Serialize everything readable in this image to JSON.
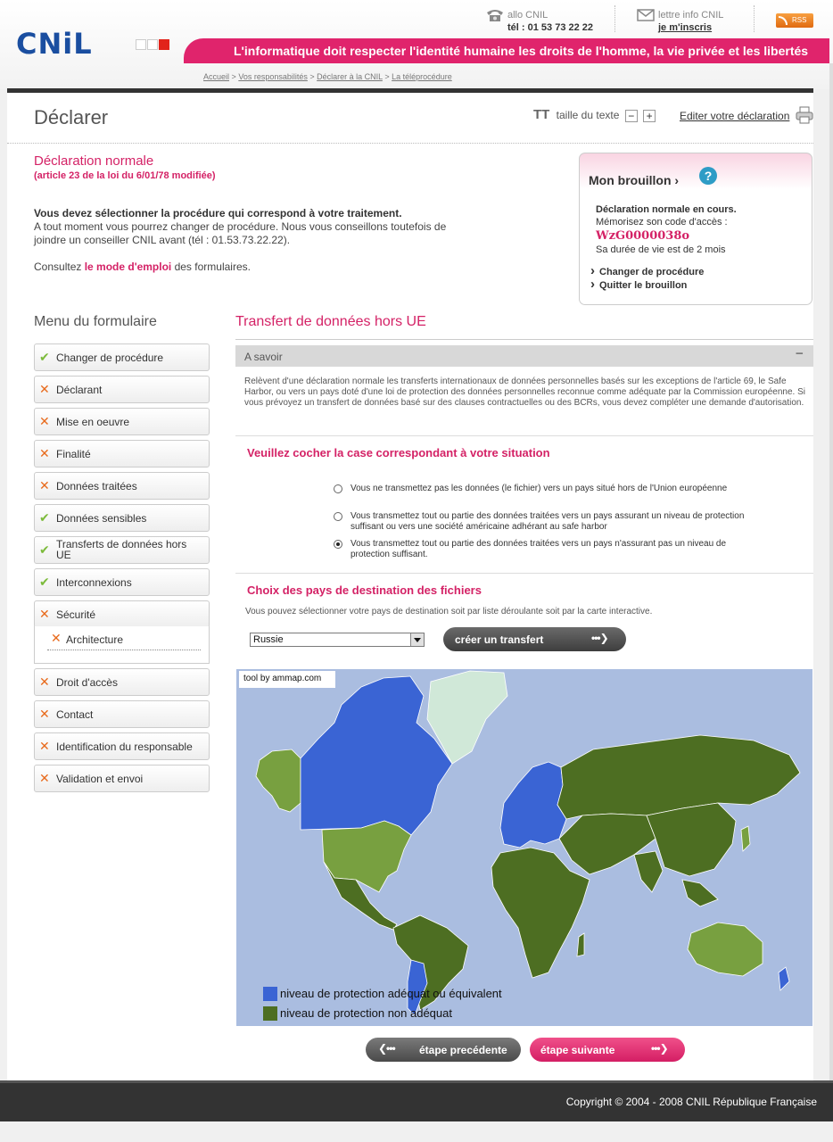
{
  "header": {
    "logo_text": "CNiL",
    "tagline": "L'informatique doit respecter l'identité humaine les droits de l'homme, la vie privée et les libertés",
    "allo_label": "allo CNIL",
    "allo_phone": "tél : 01 53 73 22 22",
    "lettre_label": "lettre info CNIL",
    "lettre_link": "je m'inscris",
    "rss": "RSS",
    "colors": {
      "brand_blue": "#1a4ea0",
      "accent_pink": "#e0246c"
    }
  },
  "breadcrumb": {
    "items": [
      "Accueil",
      "Vos responsabilités",
      "Déclarer à la CNIL",
      "La téléprocédure"
    ],
    "sep": ">"
  },
  "page": {
    "title": "Déclarer",
    "text_size_icon": "TT",
    "text_size_label": "taille du texte",
    "minus": "−",
    "plus": "+",
    "edit_label": "Editer votre déclaration"
  },
  "declaration": {
    "title": "Déclaration normale",
    "subtitle": "(article 23 de la loi du 6/01/78 modifiée)",
    "intro_bold": "Vous devez sélectionner la procédure qui correspond à votre traitement.",
    "intro_rest": "A tout moment vous pourrez changer de procédure. Nous vous conseillons toutefois de joindre un conseiller CNIL avant (tél : 01.53.73.22.22).",
    "consult_pre": "Consultez ",
    "consult_link": "le mode d'emploi",
    "consult_post": " des formulaires."
  },
  "brouillon": {
    "title": "Mon brouillon",
    "arrow": "›",
    "help": "?",
    "status": "Déclaration normale en cours.",
    "memo": "Mémorisez son code d'accès :",
    "code": "WzG0000038o",
    "duree": "Sa durée de vie est de 2 mois",
    "links": [
      "Changer de procédure",
      "Quitter le brouillon"
    ]
  },
  "menu": {
    "title": "Menu du formulaire",
    "items": [
      {
        "label": "Changer de procédure",
        "status": "ok"
      },
      {
        "label": "Déclarant",
        "status": "ko"
      },
      {
        "label": "Mise en oeuvre",
        "status": "ko"
      },
      {
        "label": "Finalité",
        "status": "ko"
      },
      {
        "label": "Données traitées",
        "status": "ko"
      },
      {
        "label": "Données sensibles",
        "status": "ok"
      },
      {
        "label": "Transferts de données hors UE",
        "status": "ok"
      },
      {
        "label": "Interconnexions",
        "status": "ok"
      },
      {
        "label": "Sécurité",
        "status": "ko"
      },
      {
        "label": "Droit d'accès",
        "status": "ko"
      },
      {
        "label": "Contact",
        "status": "ko"
      },
      {
        "label": "Identification du responsable",
        "status": "ko"
      },
      {
        "label": "Validation et envoi",
        "status": "ko"
      }
    ],
    "sub_item": {
      "label": "Architecture",
      "status": "ko"
    }
  },
  "section": {
    "title": "Transfert de données hors UE",
    "asavoir_label": "A savoir",
    "asavoir_toggle": "−",
    "asavoir_text": "Relèvent d'une déclaration normale les transferts internationaux de données personnelles basés sur les exceptions de l'article 69, le Safe Harbor, ou vers un pays doté d'une loi de protection des données personnelles reconnue comme adéquate par la Commission européenne. Si vous prévoyez un transfert de données basé sur des clauses contractuelles ou des BCRs, vous devez compléter une demande d'autorisation.",
    "question": "Veuillez cocher la case correspondant à votre situation",
    "options": [
      {
        "label": "Vous ne transmettez pas les données (le fichier) vers un pays situé hors de l'Union européenne",
        "checked": false
      },
      {
        "label": "Vous transmettez tout ou partie des données traitées vers un pays assurant un niveau de protection suffisant ou vers une société américaine adhérant au safe harbor",
        "checked": false
      },
      {
        "label": "Vous transmettez tout ou partie des données traitées vers un pays n'assurant pas un niveau de protection suffisant.",
        "checked": true
      }
    ],
    "choix_title": "Choix des pays de destination des fichiers",
    "choix_sub": "Vous pouvez sélectionner votre pays de destination soit par liste déroulante soit par la carte interactive.",
    "select_value": "Russie",
    "create_button": "créer un transfert",
    "button_arrows": "•••❯",
    "button_arrows_left": "❮•••"
  },
  "map": {
    "credit": "tool by ammap.com",
    "legend": [
      {
        "label": "niveau de protection adéquat ou équivalent",
        "color": "#3a64d4"
      },
      {
        "label": "niveau de protection non adéquat",
        "color": "#4d6e22"
      }
    ],
    "colors": {
      "ocean": "#aabde0",
      "light_green": "#78a040",
      "greenland": "#d0e8d8"
    }
  },
  "nav": {
    "prev": "étape precédente",
    "next": "étape suivante"
  },
  "footer": {
    "copyright": "Copyright © 2004 - 2008 CNIL République Française"
  }
}
